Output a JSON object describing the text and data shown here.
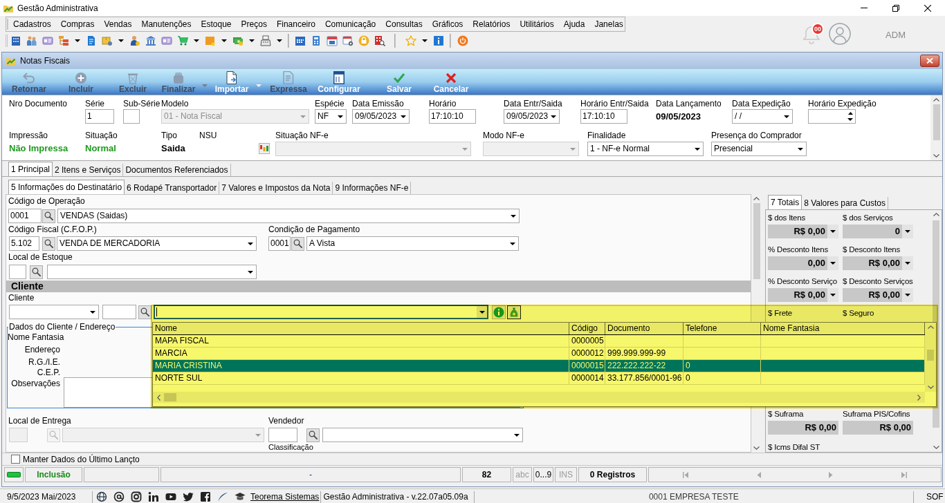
{
  "app": {
    "title": "Gestão Administrativa",
    "menu": [
      "Cadastros",
      "Compras",
      "Vendas",
      "Manutenções",
      "Estoque",
      "Preços",
      "Financeiro",
      "Comunicação",
      "Consultas",
      "Gráficos",
      "Relatórios",
      "Utilitários",
      "Ajuda",
      "Janelas"
    ],
    "notification_count": "00",
    "user": "ADM"
  },
  "window": {
    "title": "Notas Fiscais"
  },
  "actions": [
    {
      "label": "Retornar",
      "disabled": true,
      "has_menu": false
    },
    {
      "label": "Incluir",
      "disabled": true,
      "has_menu": false
    },
    {
      "label": "Excluir",
      "disabled": true,
      "has_menu": false
    },
    {
      "label": "Finalizar",
      "disabled": true,
      "has_menu": true
    },
    {
      "label": "Importar",
      "disabled": false,
      "has_menu": true
    },
    {
      "label": "Expressa",
      "disabled": true,
      "has_menu": false
    },
    {
      "label": "Configurar",
      "disabled": false,
      "has_menu": false
    },
    {
      "label": "Salvar",
      "disabled": false,
      "has_menu": false
    },
    {
      "label": "Cancelar",
      "disabled": false,
      "has_menu": false
    }
  ],
  "header": {
    "row_1": [
      {
        "kind": "label",
        "label": "Nro Documento"
      },
      {
        "kind": "input",
        "label": "Série",
        "value": "1",
        "disabled": false
      },
      {
        "kind": "input",
        "label": "Sub-Série",
        "disabled": false
      },
      {
        "kind": "combo",
        "label": "Modelo",
        "value": "01 - Nota Fiscal",
        "disabled": true
      },
      {
        "kind": "combo",
        "label": "Espécie",
        "value": "NF",
        "disabled": false
      },
      {
        "kind": "combo",
        "label": "Data Emissão",
        "value": "09/05/2023",
        "disabled": false
      },
      {
        "kind": "input",
        "label": "Horário",
        "value": "17:10:10",
        "disabled": false
      },
      {
        "kind": "combo",
        "label": "Data Entr/Saida",
        "value": "09/05/2023",
        "disabled": false
      },
      {
        "kind": "input",
        "label": "Horário Entr/Saida",
        "value": "17:10:10",
        "disabled": false
      },
      {
        "kind": "text",
        "label": "Data Lançamento",
        "value": "09/05/2023",
        "color": "#000000"
      },
      {
        "kind": "combo",
        "label": "Data Expedição",
        "value": "/ /",
        "disabled": false
      },
      {
        "kind": "spin",
        "label": "Horário Expedição",
        "disabled": false
      }
    ],
    "row_2": [
      {
        "kind": "text",
        "label": "Impressão",
        "value": "Não Impressa",
        "color": "#1f9a1f"
      },
      {
        "kind": "text",
        "label": "Situação",
        "value": "Normal",
        "color": "#1f9a1f"
      },
      {
        "kind": "text",
        "label": "Tipo",
        "value": "Saida",
        "color": "#000000"
      },
      {
        "kind": "button",
        "label": "NSU",
        "disabled": false
      },
      {
        "kind": "combo",
        "label": "Situação NF-e",
        "disabled": true
      },
      {
        "kind": "combo",
        "label": "Modo NF-e",
        "disabled": true
      },
      {
        "kind": "combo",
        "label": "Finalidade",
        "value": "1 - NF-e Normal",
        "disabled": false
      },
      {
        "kind": "combo",
        "label": "Presença do Comprador",
        "value": "Presencial",
        "disabled": false
      }
    ]
  },
  "tabs": [
    {
      "label": "1 Principal",
      "selected": true
    },
    {
      "label": "2 Itens e Serviços",
      "selected": false
    },
    {
      "label": "Documentos Referenciados",
      "selected": false
    }
  ],
  "subtabs": [
    {
      "label": "5 Informações do Destinatário",
      "selected": true
    },
    {
      "label": "6 Rodapé Transportador",
      "selected": false
    },
    {
      "label": "7 Valores e Impostos da Nota",
      "selected": false
    },
    {
      "label": "9 Informações NF-e",
      "selected": false
    }
  ],
  "recipient": {
    "operation": {
      "label": "Código de Operação",
      "code": "0001",
      "description": "VENDAS (Saidas)",
      "disabled": false
    },
    "cfop": {
      "label": "Código Fiscal (C.F.O.P.)",
      "code": "5.102",
      "description": "VENDA DE MERCADORIA",
      "disabled": false
    },
    "payment": {
      "label": "Condição de Pagamento",
      "code": "0001",
      "description": "A Vista",
      "disabled": false
    },
    "stock": {
      "label": "Local de Estoque",
      "disabled": false
    },
    "section_title": "Cliente",
    "client": {
      "label": "Cliente"
    },
    "address": {
      "title": "Dados do Cliente / Endereço",
      "labels": [
        "Nome Fantasia",
        "Endereço",
        "R.G./I.E.",
        "C.E.P.",
        "Observações"
      ]
    },
    "delivery": {
      "label": "Local de Entrega",
      "disabled": true
    },
    "seller": {
      "label": "Vendedor",
      "disabled": false
    },
    "classification": {
      "label": "Classificação"
    }
  },
  "client_lookup": {
    "columns": [
      "Nome",
      "Código",
      "Documento",
      "Telefone",
      "Nome Fantasia"
    ],
    "rows": [
      {
        "name": "MAPA FISCAL",
        "code": "0000005",
        "selected": false
      },
      {
        "name": "MARCIA",
        "code": "0000012",
        "document": "999.999.999-99",
        "selected": false
      },
      {
        "name": "MARIA CRISTINA",
        "code": "0000015",
        "document": "222.222.222-22",
        "phone": "0",
        "selected": true
      },
      {
        "name": "NORTE SUL",
        "code": "0000014",
        "document": "33.177.856/0001-96",
        "phone": "0",
        "selected": false
      }
    ]
  },
  "totals": {
    "tabs": [
      {
        "label": "7 Totais",
        "selected": true
      },
      {
        "label": "8 Valores para Custos",
        "selected": false
      }
    ],
    "upper": [
      {
        "label": "$ dos Itens",
        "value": "R$ 0,00",
        "kind": "dropdown"
      },
      {
        "label": "$ dos Serviços",
        "value": "0",
        "kind": "dropdown"
      },
      {
        "label": "% Desconto Itens",
        "value": "0,00",
        "kind": "dropdown"
      },
      {
        "label": "$ Desconto Itens",
        "value": "R$ 0,00",
        "kind": "dropdown"
      },
      {
        "label": "% Desconto Serviço",
        "value": "R$ 0,00",
        "kind": "dropdown"
      },
      {
        "label": "$ Desconto Serviços",
        "value": "R$ 0,00",
        "kind": "dropdown"
      },
      {
        "label": "$ Frete",
        "kind": "label"
      },
      {
        "label": "$ Seguro",
        "kind": "label"
      }
    ],
    "lower": [
      {
        "label": "$ Suframa",
        "value": "R$ 0,00",
        "kind": "plain"
      },
      {
        "label": "Suframa PIS/Cofins",
        "value": "R$ 0,00",
        "kind": "plain"
      },
      {
        "label": "$ Icms Difal ST",
        "kind": "label"
      }
    ]
  },
  "keep_last": {
    "label": "Manter Dados do Último Lançto",
    "checked": false
  },
  "status_bar": {
    "mode": "Inclusão",
    "message": "-",
    "number": "82",
    "indicators": [
      {
        "label": "abc",
        "on": false
      },
      {
        "label": "0...9",
        "on": true
      },
      {
        "label": "INS",
        "on": false
      }
    ],
    "records": "0 Registros"
  },
  "footer": {
    "date": "9/5/2023 Mai/2023",
    "link": "Teorema Sistemas",
    "version": "Gestão Administrativa - v.22.07a05.09a",
    "company": "0001 EMPRESA TESTE",
    "user": "SOF"
  }
}
